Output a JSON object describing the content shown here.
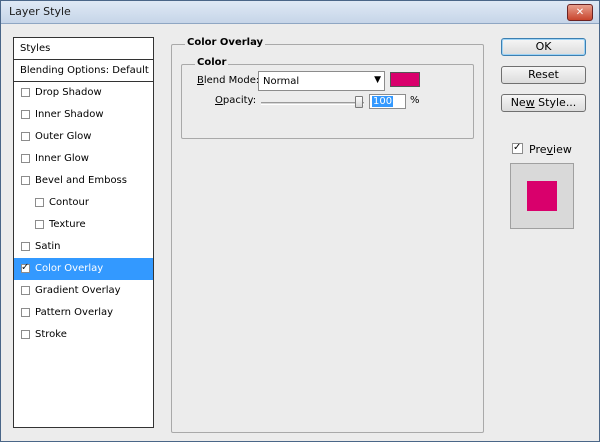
{
  "window": {
    "title": "Layer Style",
    "close_glyph": "✕"
  },
  "styles_list": {
    "header": "Styles",
    "blending": "Blending Options: Default",
    "items": [
      {
        "label": "Drop Shadow",
        "checked": false
      },
      {
        "label": "Inner Shadow",
        "checked": false
      },
      {
        "label": "Outer Glow",
        "checked": false
      },
      {
        "label": "Inner Glow",
        "checked": false
      },
      {
        "label": "Bevel and Emboss",
        "checked": false
      },
      {
        "label": "Contour",
        "checked": false
      },
      {
        "label": "Texture",
        "checked": false
      },
      {
        "label": "Satin",
        "checked": false
      },
      {
        "label": "Color Overlay",
        "checked": true,
        "selected": true
      },
      {
        "label": "Gradient Overlay",
        "checked": false
      },
      {
        "label": "Pattern Overlay",
        "checked": false
      },
      {
        "label": "Stroke",
        "checked": false
      }
    ]
  },
  "panel": {
    "title": "Color Overlay",
    "section": "Color",
    "blend_mode_label_prefix": "B",
    "blend_mode_label_rest": "lend Mode:",
    "blend_mode_value": "Normal",
    "overlay_color": "#d9006c",
    "opacity_label_prefix": "O",
    "opacity_label_rest": "pacity:",
    "opacity_value": "100",
    "opacity_unit": "%",
    "dropdown_glyph": "▼"
  },
  "buttons": {
    "ok": "OK",
    "reset": "Reset",
    "new_style_prefix": "Ne",
    "new_style_underline": "w",
    "new_style_rest": " Style..."
  },
  "preview": {
    "label_prefix": "Pre",
    "label_underline": "v",
    "label_rest": "iew",
    "checked": true,
    "swatch_color": "#d9006c"
  },
  "check_glyph": "✓"
}
